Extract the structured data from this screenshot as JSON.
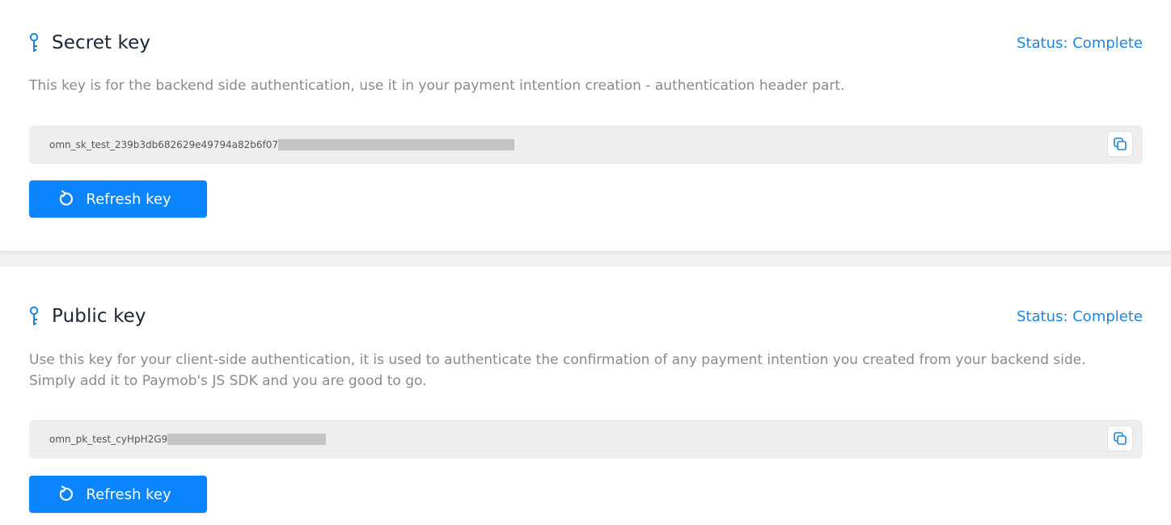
{
  "secret": {
    "title": "Secret key",
    "status": "Status: Complete",
    "description": "This key is for the backend side authentication, use it in your payment intention creation - authentication header part.",
    "key_value": "omn_sk_test_239b3db682629e49794a82b6f07",
    "refresh_label": "Refresh key"
  },
  "public": {
    "title": "Public key",
    "status": "Status: Complete",
    "description_line1": "Use this key for your client-side authentication, it is used to authenticate the confirmation of any payment intention you created from your backend side.",
    "description_line2": "Simply add it to Paymob's JS SDK and you are good to go.",
    "key_value": "omn_pk_test_cyHpH2G9",
    "refresh_label": "Refresh key"
  },
  "icons": {
    "title_icon": "key-icon",
    "copy_icon": "copy-icon",
    "refresh_icon": "refresh-icon"
  },
  "colors": {
    "accent": "#0a84ff",
    "status": "#1d86e0",
    "key_box": "#eeeeee",
    "redaction": "#c4c4c4"
  }
}
